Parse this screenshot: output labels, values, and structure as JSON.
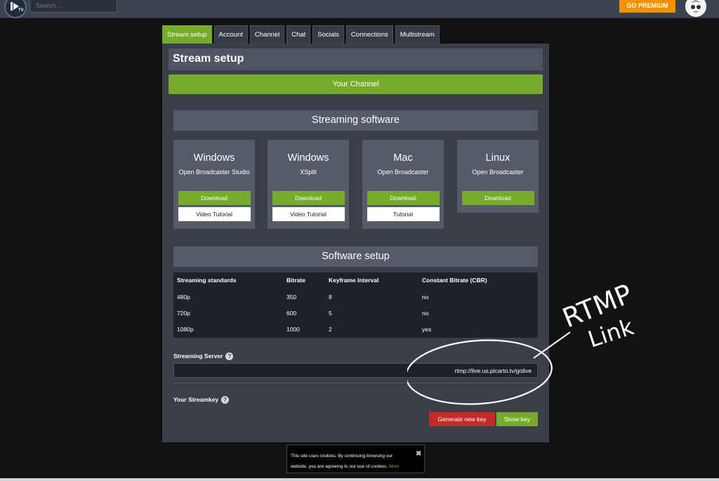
{
  "topbar": {
    "logo_text": "TV",
    "search_placeholder": "Search...",
    "premium_label": "GO PREMIUM"
  },
  "tabs": [
    {
      "label": "Stream setup",
      "active": true
    },
    {
      "label": "Account"
    },
    {
      "label": "Channel"
    },
    {
      "label": "Chat"
    },
    {
      "label": "Socials"
    },
    {
      "label": "Connections"
    },
    {
      "label": "Multistream"
    }
  ],
  "panel": {
    "title": "Stream setup",
    "your_channel": "Your Channel",
    "streaming_software_title": "Streaming software",
    "software_setup_title": "Software setup"
  },
  "software": [
    {
      "os": "Windows",
      "name": "Open Broadcaster Studio",
      "download": "Download",
      "tutorial": "Video Tutorial"
    },
    {
      "os": "Windows",
      "name": "XSplit",
      "download": "Download",
      "tutorial": "Video Tutorial"
    },
    {
      "os": "Mac",
      "name": "Open Broadcaster",
      "download": "Download",
      "tutorial": "Tutorial"
    },
    {
      "os": "Linux",
      "name": "Open Broadcaster",
      "download": "Download"
    }
  ],
  "setup_table": {
    "headers": [
      "Streaming standards",
      "Bitrate",
      "Keyframe Interval",
      "Constant Bitrate (CBR)"
    ],
    "rows": [
      [
        "480p",
        "350",
        "8",
        "no"
      ],
      [
        "720p",
        "600",
        "5",
        "no"
      ],
      [
        "1080p",
        "1000",
        "2",
        "yes"
      ]
    ]
  },
  "streaming_server": {
    "label": "Streaming Server",
    "value": "rtmp://live.us.picarto.tv/golive",
    "help": "?"
  },
  "streamkey": {
    "label": "Your Streamkey",
    "help": "?",
    "generate_label": "Generate new key",
    "show_label": "Show key"
  },
  "cookie": {
    "text": "This site uses cookies. By continuing browsing our website, you are agreeing to our use of cookies.",
    "more": "More",
    "close": "✖"
  },
  "annotation": {
    "line1": "RTMP",
    "line2": "Link"
  },
  "colors": {
    "accent_green": "#77ac2b",
    "premium_orange": "#f39200",
    "danger_red": "#c82828",
    "panel_bg": "#3a3f49"
  }
}
